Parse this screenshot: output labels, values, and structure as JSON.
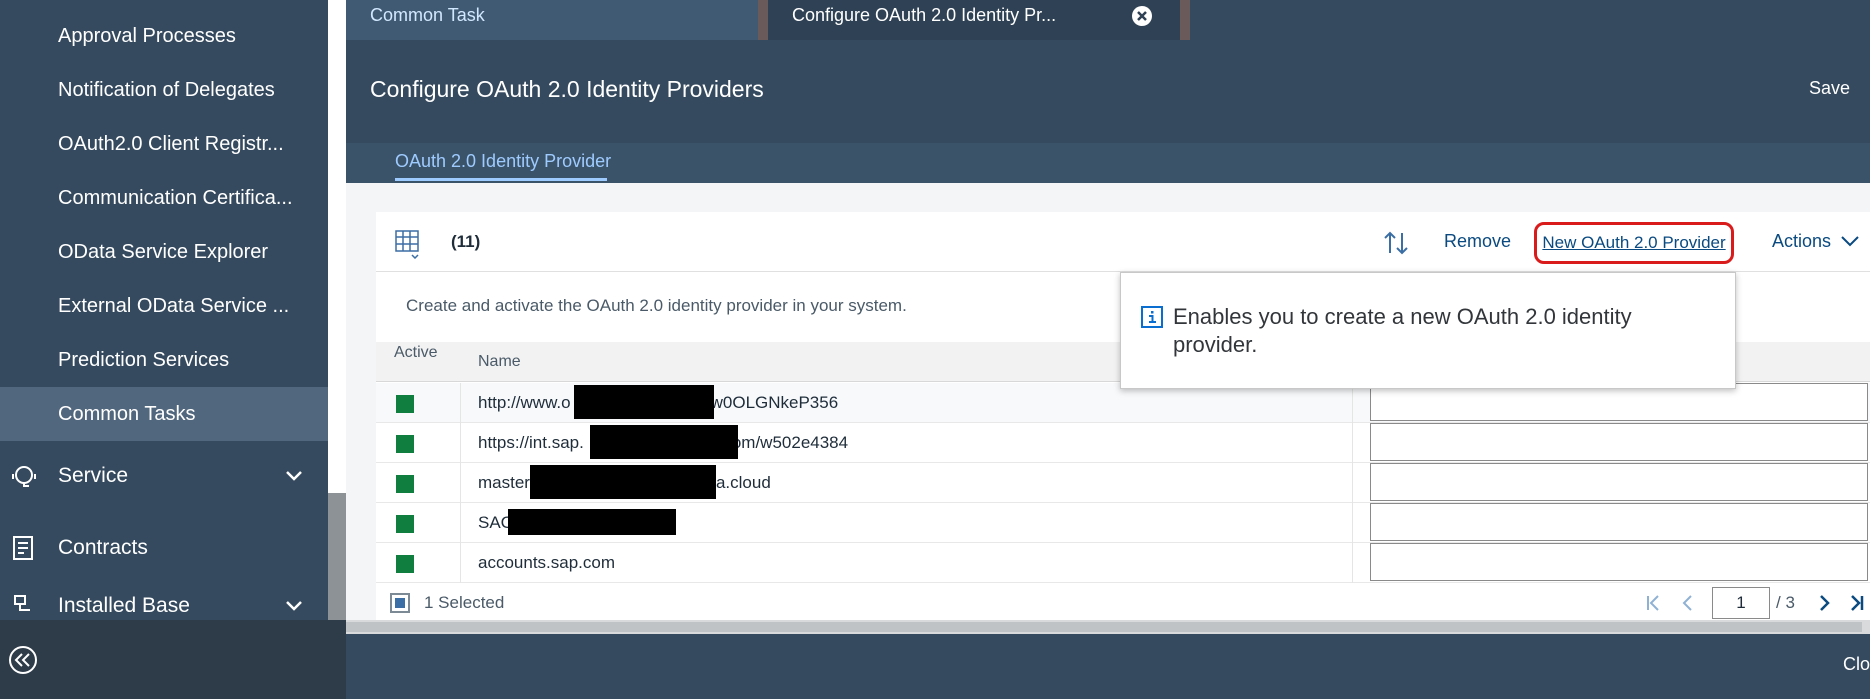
{
  "sidebar": {
    "sub_items": [
      {
        "label": "Approval Processes"
      },
      {
        "label": "Notification of Delegates"
      },
      {
        "label": "OAuth2.0 Client Registr..."
      },
      {
        "label": "Communication Certifica..."
      },
      {
        "label": "OData Service Explorer"
      },
      {
        "label": "External OData Service ..."
      },
      {
        "label": "Prediction Services"
      },
      {
        "label": "Common Tasks"
      }
    ],
    "main_items": [
      {
        "label": "Service",
        "icon": "service-icon"
      },
      {
        "label": "Contracts",
        "icon": "contracts-icon"
      },
      {
        "label": "Installed Base",
        "icon": "installed-base-icon"
      }
    ]
  },
  "tabs": [
    {
      "label": "Common Task"
    },
    {
      "label": "Configure OAuth 2.0 Identity Pr..."
    }
  ],
  "header": {
    "title": "Configure OAuth 2.0 Identity Providers",
    "save_label": "Save"
  },
  "subtab": {
    "label": "OAuth 2.0 Identity Provider"
  },
  "toolbar": {
    "count": "(11)",
    "remove_label": "Remove",
    "new_label": "New OAuth 2.0 Provider",
    "actions_label": "Actions"
  },
  "description": "Create and activate the OAuth 2.0 identity provider in your system.",
  "table": {
    "columns": [
      "Active",
      "Name"
    ],
    "rows": [
      {
        "name_prefix": "http://www.o",
        "name_suffix": "w0OLGNkeP356"
      },
      {
        "name_prefix": "https://int.sap.",
        "name_suffix": "om/w502e4384"
      },
      {
        "name_prefix": "master",
        "name_suffix": "a.cloud"
      },
      {
        "name_prefix": "SAC",
        "name_suffix": ""
      },
      {
        "name_prefix": "accounts.sap.com",
        "name_suffix": ""
      }
    ]
  },
  "footer": {
    "selected": "1 Selected",
    "page": "1",
    "total": "/ 3"
  },
  "bottom": {
    "close_label": "Clo"
  },
  "tooltip": {
    "text": "Enables you to create a new OAuth 2.0 identity provider."
  },
  "colors": {
    "shell": "#354a5f",
    "accent_link": "#0a4a80",
    "highlight": "#d91b1b",
    "status_active": "#107e3e"
  }
}
